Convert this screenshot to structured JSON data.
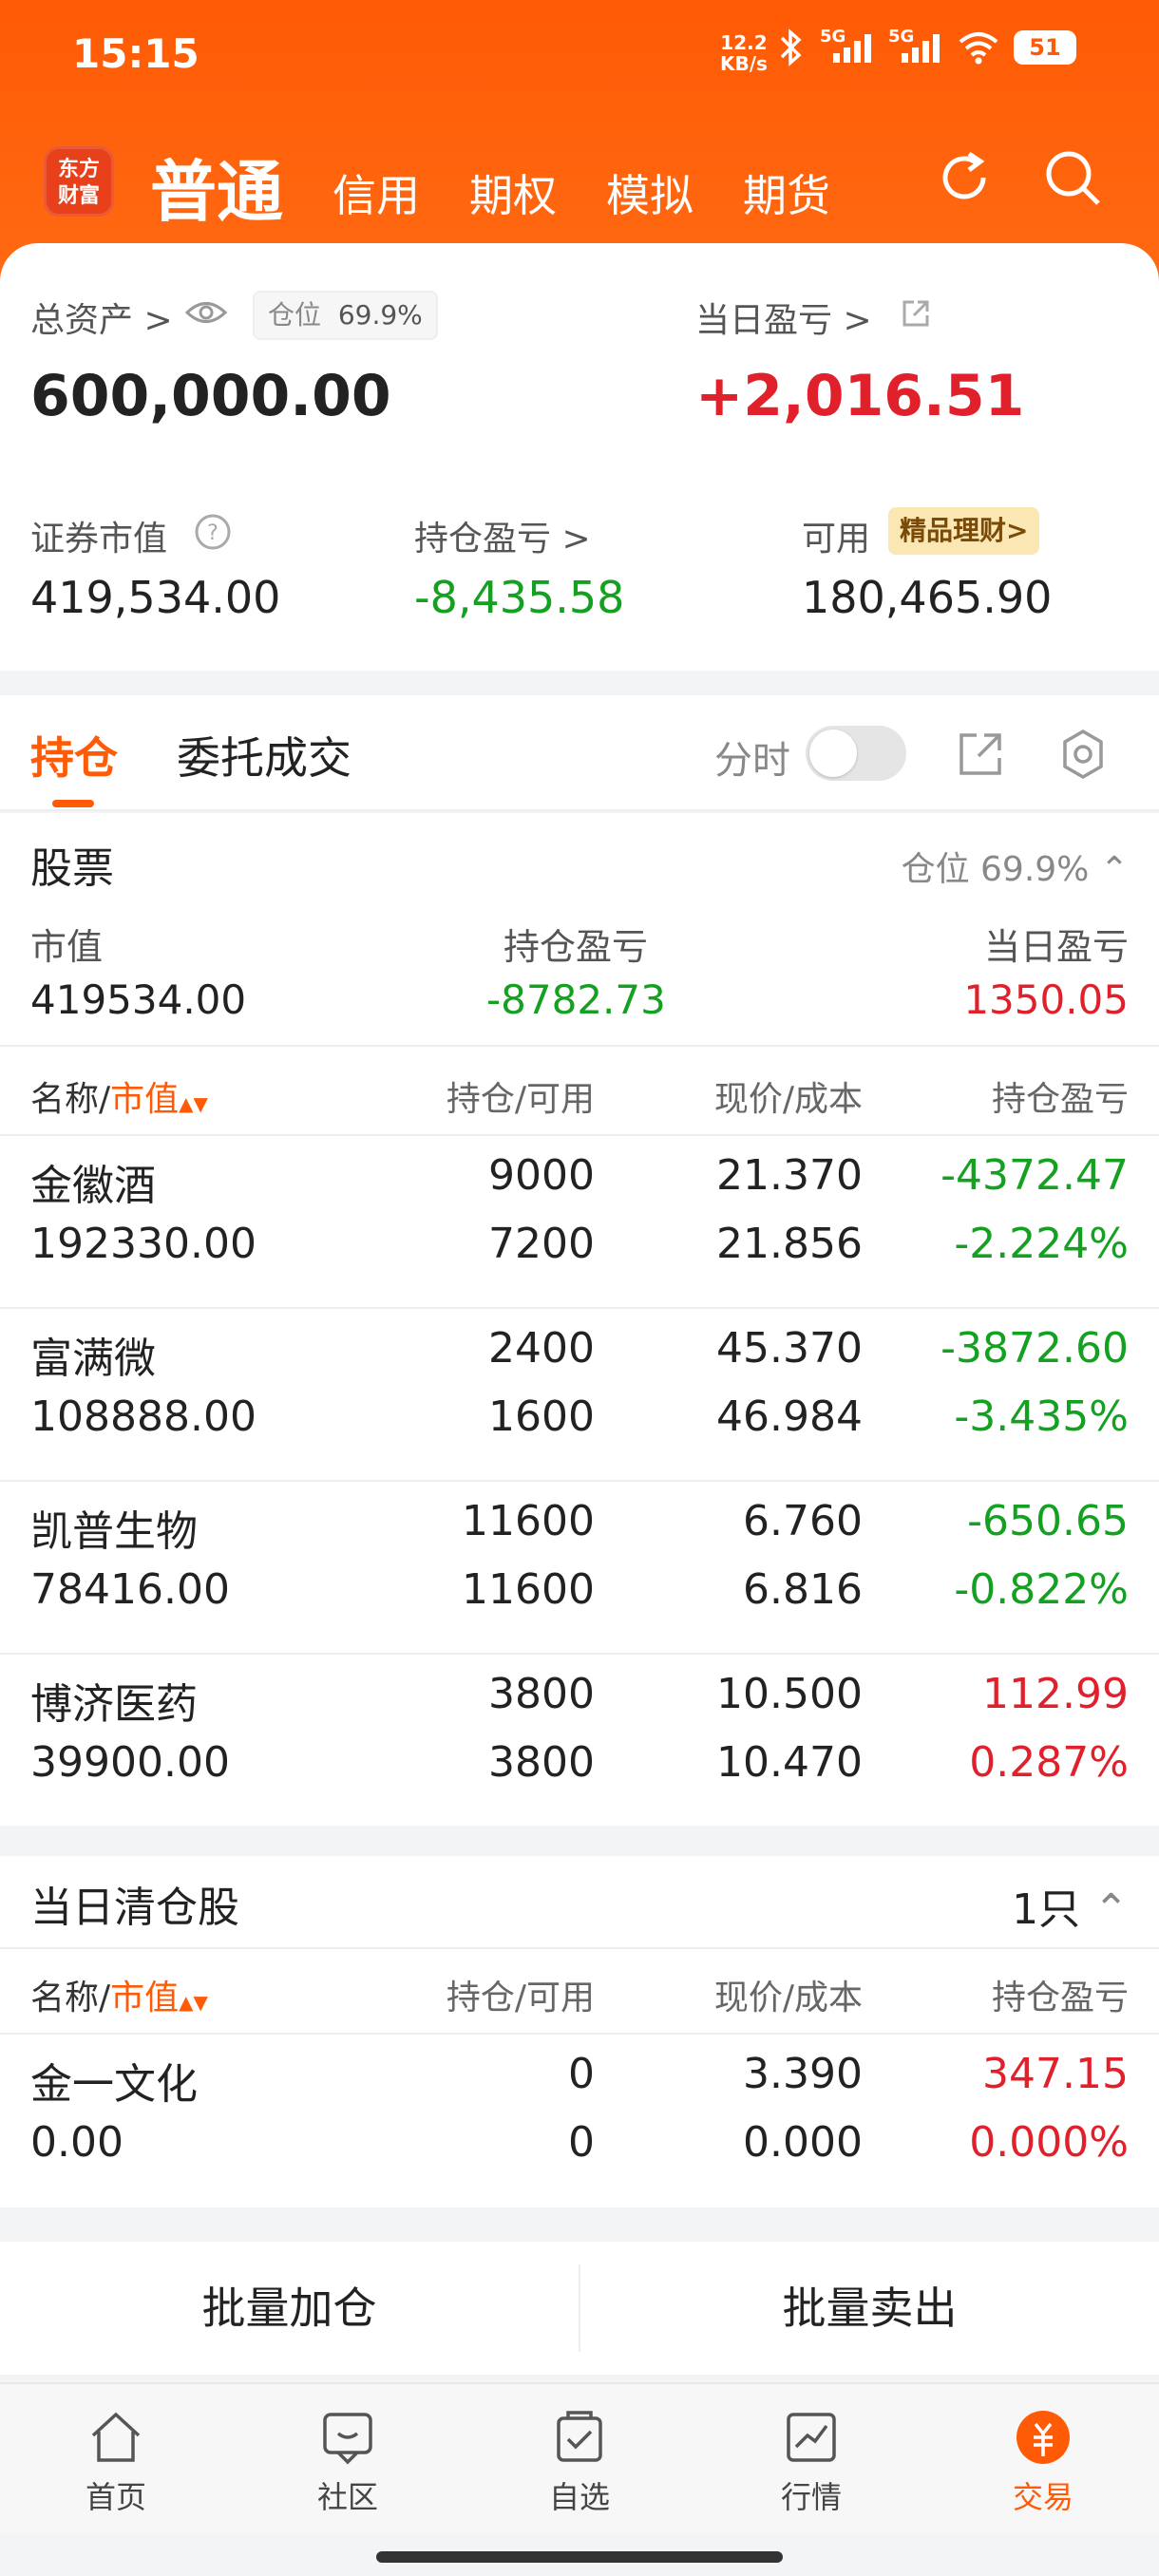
{
  "status_bar": {
    "time": "15:15",
    "speed_top": "12.2",
    "speed_bottom": "KB/s",
    "sig1": "5G",
    "sig2": "5G",
    "battery": "51"
  },
  "header": {
    "logo_line1": "东方",
    "logo_line2": "财富",
    "tabs": [
      "普通",
      "信用",
      "期权",
      "模拟",
      "期货"
    ]
  },
  "summary": {
    "total_assets_label": "总资产 >",
    "position_label": "仓位",
    "position_value": "69.9%",
    "total_assets_value": "600,000.00",
    "daily_pl_label": "当日盈亏 >",
    "daily_pl_value": "+2,016.51",
    "securities_value_label": "证券市值",
    "securities_value": "419,534.00",
    "holding_pl_label": "持仓盈亏 >",
    "holding_pl_value": "-8,435.58",
    "available_label": "可用",
    "available_tag": "精品理财>",
    "available_value": "180,465.90"
  },
  "pos_tabs": {
    "holding": "持仓",
    "orders": "委托成交",
    "intraday": "分时"
  },
  "stocks": {
    "title": "股票",
    "position_text": "仓位 69.9%",
    "sum_labels": [
      "市值",
      "持仓盈亏",
      "当日盈亏"
    ],
    "sum_values": [
      "419534.00",
      "-8782.73",
      "1350.05"
    ],
    "col_name": "名称/",
    "col_mv": "市值",
    "col_hold": "持仓/可用",
    "col_price": "现价/成本",
    "col_pl": "持仓盈亏",
    "rows": [
      {
        "name": "金徽酒",
        "mv": "192330.00",
        "hold": "9000",
        "avail": "7200",
        "price": "21.370",
        "cost": "21.856",
        "pl": "-4372.47",
        "pct": "-2.224%"
      },
      {
        "name": "富满微",
        "mv": "108888.00",
        "hold": "2400",
        "avail": "1600",
        "price": "45.370",
        "cost": "46.984",
        "pl": "-3872.60",
        "pct": "-3.435%"
      },
      {
        "name": "凯普生物",
        "mv": "78416.00",
        "hold": "11600",
        "avail": "11600",
        "price": "6.760",
        "cost": "6.816",
        "pl": "-650.65",
        "pct": "-0.822%"
      },
      {
        "name": "博济医药",
        "mv": "39900.00",
        "hold": "3800",
        "avail": "3800",
        "price": "10.500",
        "cost": "10.470",
        "pl": "112.99",
        "pct": "0.287%"
      }
    ]
  },
  "cleared": {
    "title": "当日清仓股",
    "count": "1只",
    "rows": [
      {
        "name": "金一文化",
        "mv": "0.00",
        "hold": "0",
        "avail": "0",
        "price": "3.390",
        "cost": "0.000",
        "pl": "347.15",
        "pct": "0.000%"
      }
    ]
  },
  "actions": {
    "add": "批量加仓",
    "sell": "批量卖出"
  },
  "bottom_nav": [
    "首页",
    "社区",
    "自选",
    "行情",
    "交易"
  ],
  "colors": {
    "brand": "#ff5a06",
    "up": "#e0202b",
    "down": "#14a021"
  }
}
